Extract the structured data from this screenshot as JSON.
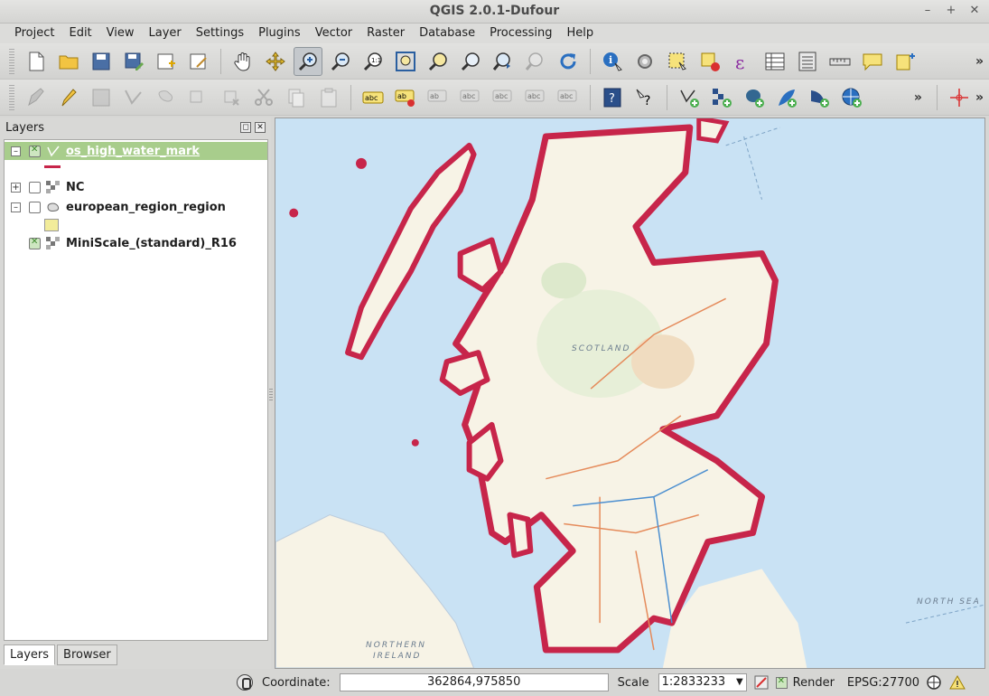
{
  "window": {
    "title": "QGIS 2.0.1-Dufour",
    "controls": [
      "–",
      "+",
      "✕"
    ]
  },
  "menu": [
    "Project",
    "Edit",
    "View",
    "Layer",
    "Settings",
    "Plugins",
    "Vector",
    "Raster",
    "Database",
    "Processing",
    "Help"
  ],
  "layers_panel": {
    "title": "Layers",
    "layers": [
      {
        "name": "os_high_water_mark",
        "checked": true,
        "selected": true,
        "expander": "–"
      },
      {
        "name": "NC",
        "checked": false,
        "selected": false,
        "expander": "+"
      },
      {
        "name": "european_region_region",
        "checked": false,
        "selected": false,
        "expander": "–"
      },
      {
        "name": "MiniScale_(standard)_R16",
        "checked": true,
        "selected": false,
        "expander": ""
      }
    ],
    "tabs": [
      "Layers",
      "Browser"
    ]
  },
  "map": {
    "labels": {
      "north_sea": "NORTH SEA",
      "northern_ireland_1": "NORTHERN",
      "northern_ireland_2": "IRELAND",
      "scotland": "SCOTLAND"
    }
  },
  "statusbar": {
    "coordinate_label": "Coordinate:",
    "coordinate_value": "362864,975850",
    "scale_label": "Scale",
    "scale_value": "1:2833233",
    "render_label": "Render",
    "crs": "EPSG:27700"
  },
  "colors": {
    "selected_layer": "#a8cd8c",
    "coastline": "#c7254a",
    "sea": "#c9e2f4",
    "land": "#f7f3e6"
  }
}
